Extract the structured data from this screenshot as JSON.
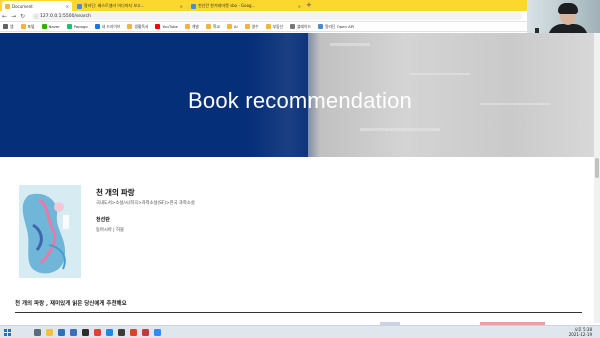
{
  "browser": {
    "tabs": [
      {
        "label": "Document",
        "active": true,
        "favicon_color": "#f3b33d"
      },
      {
        "label": "알라딘: 베스트셀러 어디까지 보고...",
        "active": false,
        "favicon_color": "#4a8ad6"
      },
      {
        "label": "천선란 한겨레마켓 sbo - Goog...",
        "active": false,
        "favicon_color": "#4a8ad6"
      }
    ],
    "new_tab_label": "+",
    "window_controls": [
      "—",
      "□",
      "✕"
    ],
    "address": "127.0.0.1:5500/search",
    "nav_icons": [
      "back-arrow-icon",
      "forward-arrow-icon",
      "reload-icon",
      "home-icon"
    ],
    "bookmarks": [
      {
        "label": "앱",
        "color": "#5f6368"
      },
      {
        "label": "포털",
        "color": "#f3b33d"
      },
      {
        "label": "Naver",
        "color": "#2db400"
      },
      {
        "label": "Papago",
        "color": "#1ec06f"
      },
      {
        "label": "내 드라이브",
        "color": "#1a73e8"
      },
      {
        "label": "생활독서",
        "color": "#f3b33d"
      },
      {
        "label": "YouTube",
        "color": "#ff0000"
      },
      {
        "label": "개발",
        "color": "#f3b33d"
      },
      {
        "label": "학교",
        "color": "#f3b33d"
      },
      {
        "label": "AI",
        "color": "#f3b33d"
      },
      {
        "label": "영수",
        "color": "#f3b33d"
      },
      {
        "label": "부동산",
        "color": "#f3b33d"
      },
      {
        "label": "블레이드",
        "color": "#777777"
      },
      {
        "label": "알라딘 Open API",
        "color": "#4a8ad6"
      }
    ]
  },
  "hero": {
    "title": "Book recommendation"
  },
  "book": {
    "title": "천 개의 파랑",
    "category": "국내도서>소설/시/희곡>과학소설(SF)>한국 과학소설",
    "author": "천선란",
    "publisher": "동아시아 | 허블"
  },
  "recommendation": {
    "heading": "천 개의 파랑 , 재미있게 읽은 당신에게 추천해요"
  },
  "taskbar": {
    "icons": [
      {
        "name": "search-icon",
        "color": "#5d6b78"
      },
      {
        "name": "file-explorer-icon",
        "color": "#f3c043"
      },
      {
        "name": "store-icon",
        "color": "#2f6fbd"
      },
      {
        "name": "mail-icon",
        "color": "#3b6fb6"
      },
      {
        "name": "terminal-icon",
        "color": "#2d2d2d"
      },
      {
        "name": "chrome-icon",
        "color": "#db4437"
      },
      {
        "name": "vscode-icon",
        "color": "#1e88e5"
      },
      {
        "name": "kakao-icon",
        "color": "#3c3c3c"
      },
      {
        "name": "powerpoint-icon",
        "color": "#d24726"
      },
      {
        "name": "app-icon",
        "color": "#c23b3b"
      },
      {
        "name": "zoom-icon",
        "color": "#2d8cff"
      }
    ],
    "time": "오후 5:38",
    "date": "2021-12-19"
  },
  "colors": {
    "hero_blue": "#062f7a",
    "tab_strip": "#fcd82e",
    "taskbar": "#dfe6ee"
  }
}
